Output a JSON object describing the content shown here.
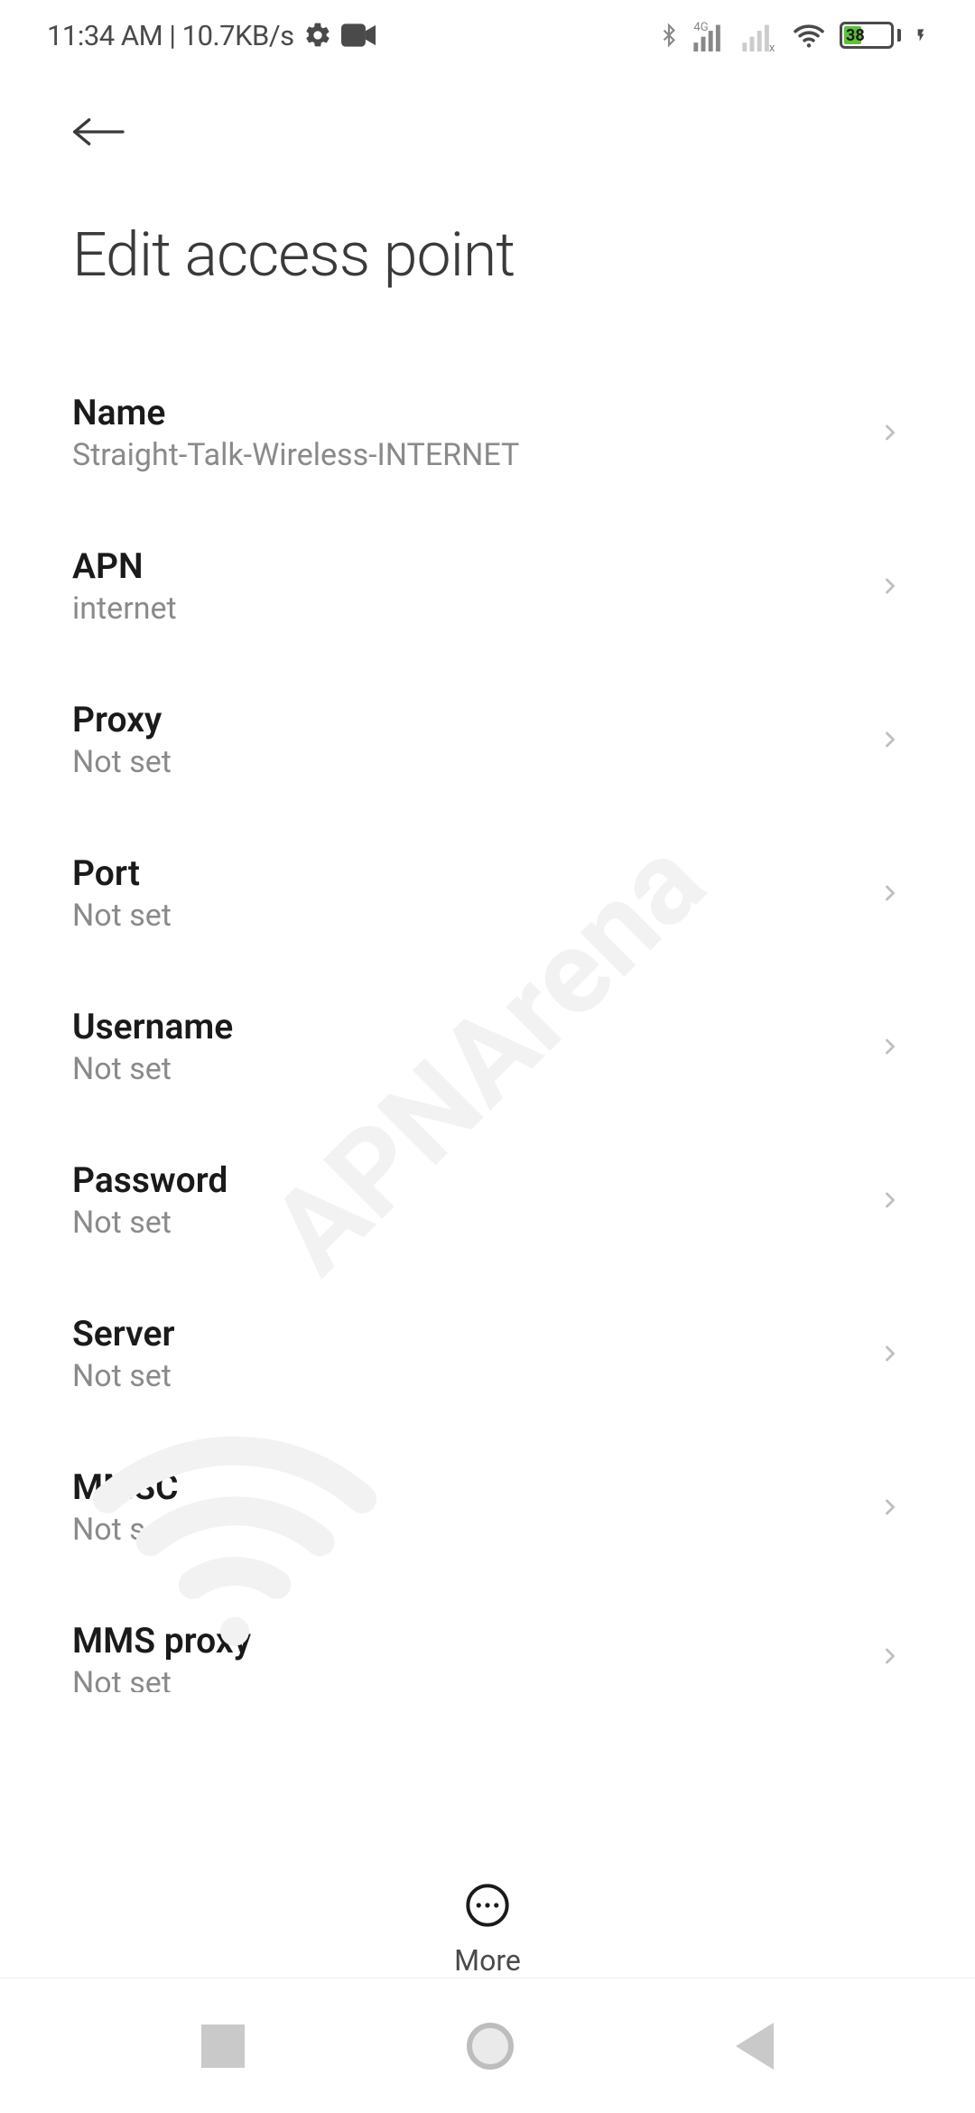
{
  "status_bar": {
    "time": "11:34 AM",
    "data_rate": "10.7KB/s",
    "battery_percent": "38"
  },
  "header": {
    "title": "Edit access point"
  },
  "rows": {
    "name": {
      "label": "Name",
      "value": "Straight-Talk-Wireless-INTERNET"
    },
    "apn": {
      "label": "APN",
      "value": "internet"
    },
    "proxy": {
      "label": "Proxy",
      "value": "Not set"
    },
    "port": {
      "label": "Port",
      "value": "Not set"
    },
    "username": {
      "label": "Username",
      "value": "Not set"
    },
    "password": {
      "label": "Password",
      "value": "Not set"
    },
    "server": {
      "label": "Server",
      "value": "Not set"
    },
    "mmsc": {
      "label": "MMSC",
      "value": "Not set"
    },
    "mms_proxy": {
      "label": "MMS proxy",
      "value": "Not set"
    }
  },
  "footer": {
    "more_label": "More"
  },
  "watermark": {
    "text": "APNArena"
  }
}
